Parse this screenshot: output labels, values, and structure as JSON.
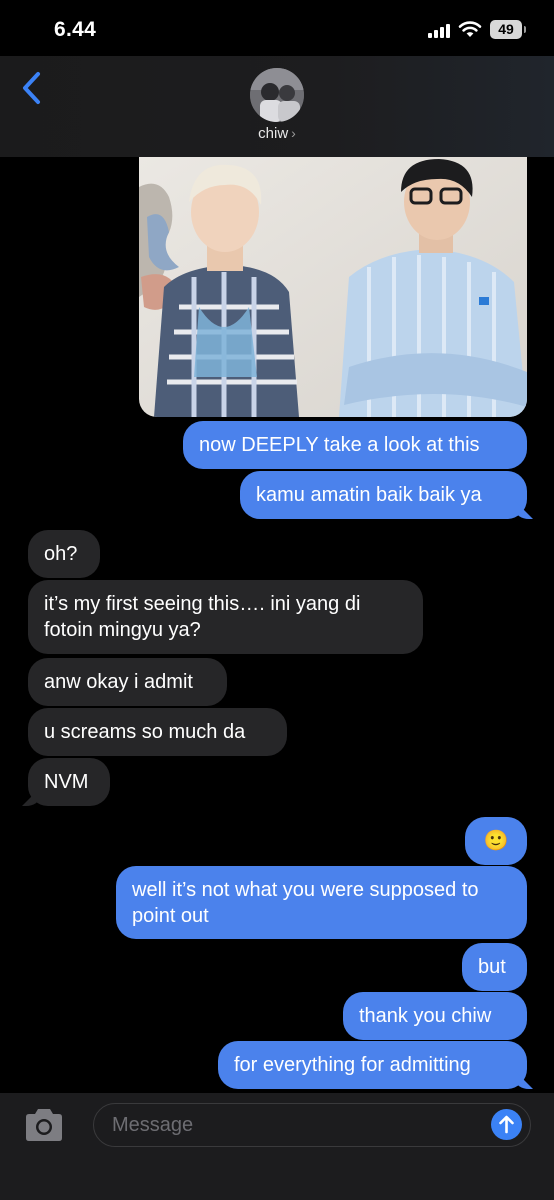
{
  "status": {
    "time": "6.44",
    "battery": "49"
  },
  "header": {
    "contact_name": "chiw",
    "chevron": "›"
  },
  "messages": [
    {
      "from": "me",
      "text": "now DEEPLY take a look at this"
    },
    {
      "from": "me",
      "text": "kamu amatin baik baik ya"
    },
    {
      "from": "them",
      "text": "oh?"
    },
    {
      "from": "them",
      "text": "it’s my first seeing this…. ini yang di fotoin mingyu ya?"
    },
    {
      "from": "them",
      "text": "anw okay i admit"
    },
    {
      "from": "them",
      "text": "u screams so much da"
    },
    {
      "from": "them",
      "text": "NVM"
    },
    {
      "from": "me",
      "text": "🙂"
    },
    {
      "from": "me",
      "text": "well it’s not what you were supposed to point out"
    },
    {
      "from": "me",
      "text": "but"
    },
    {
      "from": "me",
      "text": "thank you chiw"
    },
    {
      "from": "me",
      "text": "for everything for admitting"
    }
  ],
  "composer": {
    "placeholder": "Message"
  },
  "icons": [
    "back-chevron-icon",
    "camera-icon",
    "send-arrow-icon",
    "wifi-icon",
    "signal-icon"
  ],
  "colors": {
    "sent_bubble": "#4b82ec",
    "received_bubble": "#262628",
    "accent": "#3b82f6"
  }
}
